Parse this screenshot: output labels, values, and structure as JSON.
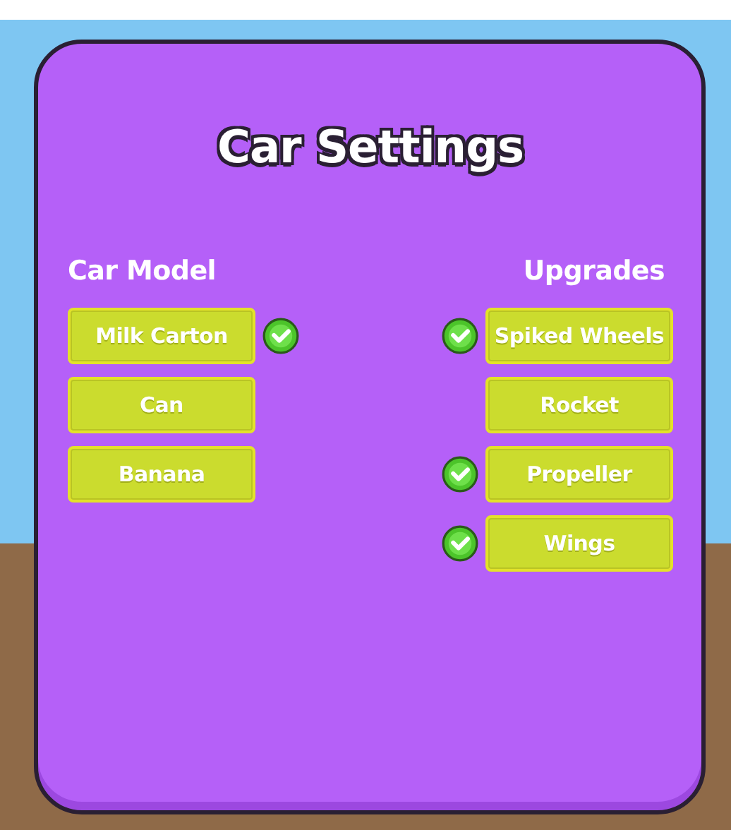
{
  "title": "Car Settings",
  "car_model": {
    "heading": "Car Model",
    "options": [
      {
        "label": "Milk Carton",
        "selected": true
      },
      {
        "label": "Can",
        "selected": false
      },
      {
        "label": "Banana",
        "selected": false
      }
    ]
  },
  "upgrades": {
    "heading": "Upgrades",
    "options": [
      {
        "label": "Spiked Wheels",
        "checked": true
      },
      {
        "label": "Rocket",
        "checked": false
      },
      {
        "label": "Propeller",
        "checked": true
      },
      {
        "label": "Wings",
        "checked": true
      }
    ]
  }
}
